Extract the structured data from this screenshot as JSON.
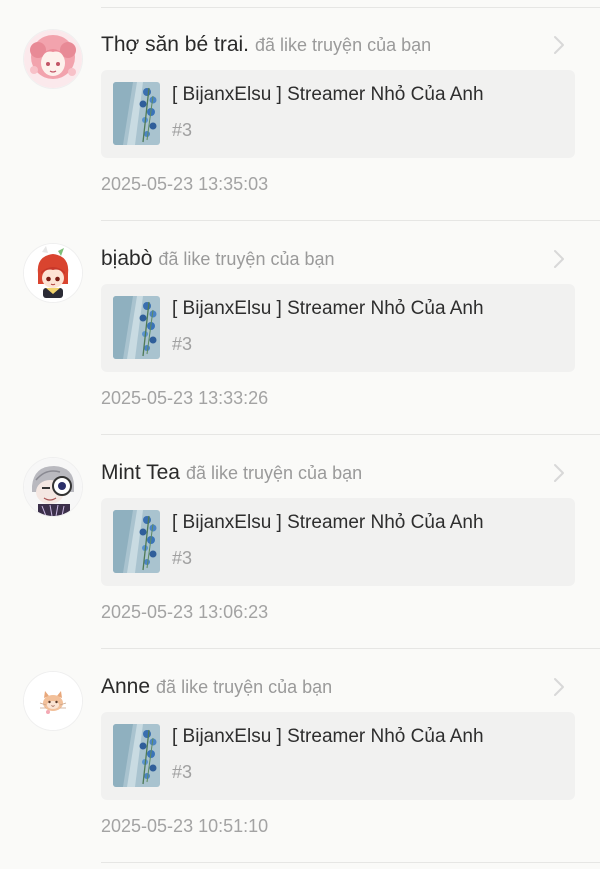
{
  "notifications": [
    {
      "user_name": "Thợ săn bé trai.",
      "action": "đã like truyện của bạn",
      "story_title": "[ BijanxElsu ] Streamer Nhỏ Của Anh",
      "chapter": "#3",
      "timestamp": "2025-05-23 13:35:03",
      "avatar_icon": "pink-hair-anime-avatar"
    },
    {
      "user_name": "bịabò",
      "action": "đã like truyện của bạn",
      "story_title": "[ BijanxElsu ] Streamer Nhỏ Của Anh",
      "chapter": "#3",
      "timestamp": "2025-05-23 13:33:26",
      "avatar_icon": "red-hair-chibi-avatar"
    },
    {
      "user_name": "Mint Tea",
      "action": "đã like truyện của bạn",
      "story_title": "[ BijanxElsu ] Streamer Nhỏ Của Anh",
      "chapter": "#3",
      "timestamp": "2025-05-23 13:06:23",
      "avatar_icon": "grey-hair-sketch-avatar"
    },
    {
      "user_name": "Anne",
      "action": "đã like truyện của bạn",
      "story_title": "[ BijanxElsu ] Streamer Nhỏ Của Anh",
      "chapter": "#3",
      "timestamp": "2025-05-23 10:51:10",
      "avatar_icon": "small-cat-avatar"
    }
  ],
  "icons": {
    "chevron": "chevron-right-icon",
    "cover": "blue-flower-cover-thumbnail"
  },
  "colors": {
    "background": "#fafaf8",
    "card": "#f1f1f0",
    "name_text": "#2a2a2a",
    "muted_text": "#9a9a9a",
    "divider": "#e6e6e4"
  }
}
